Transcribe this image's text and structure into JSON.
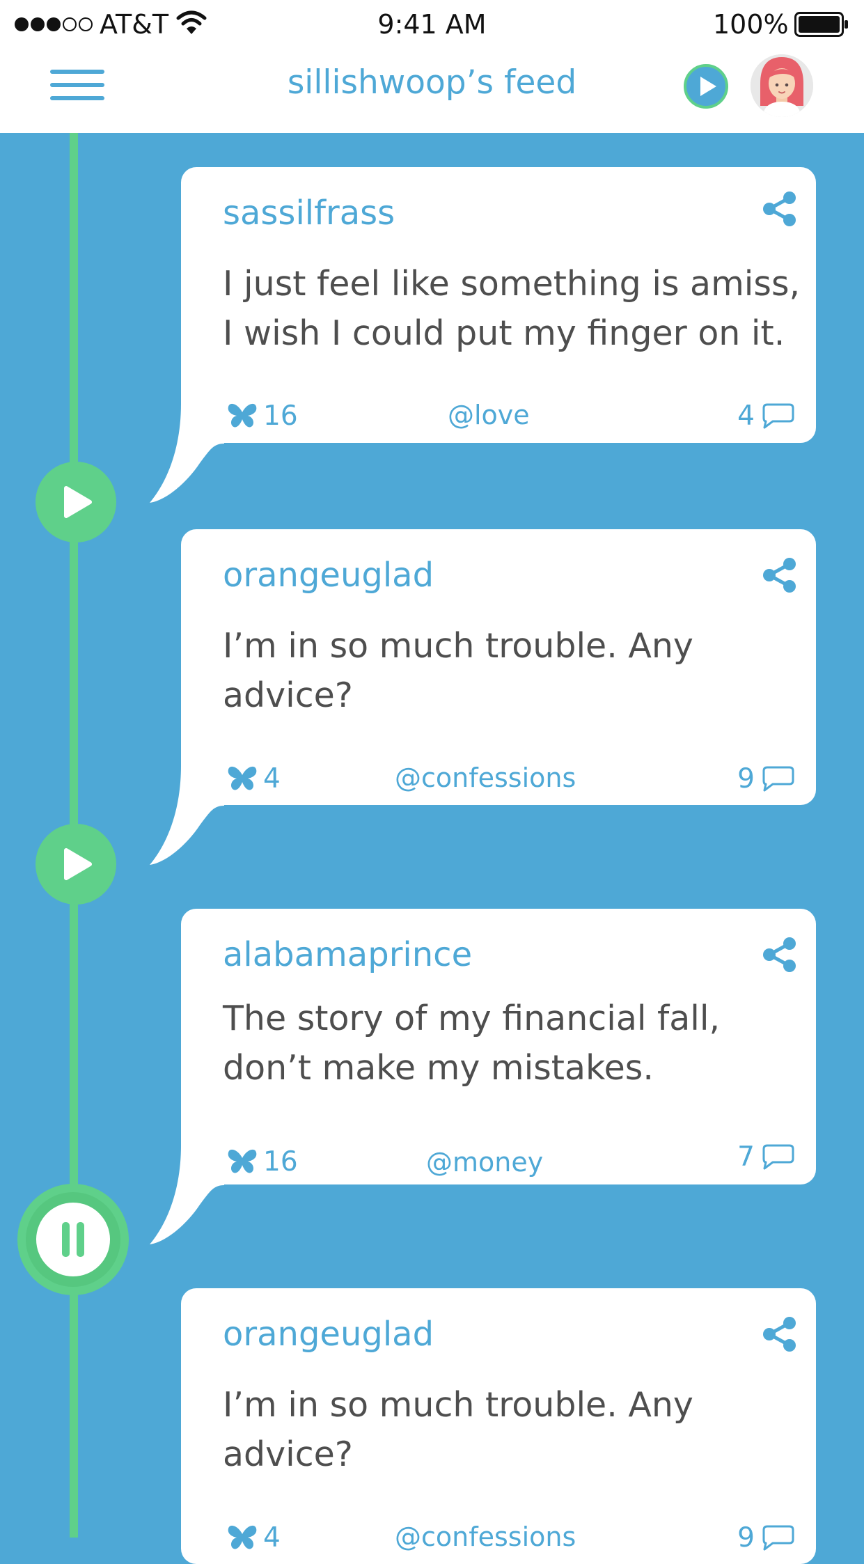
{
  "status_bar": {
    "carrier": "AT&T",
    "time": "9:41 AM",
    "battery_percent": "100%"
  },
  "nav": {
    "title": "sillishwoop’s feed"
  },
  "colors": {
    "brand_blue": "#4ea8d6",
    "timeline_green": "#5fd08a"
  },
  "feed": [
    {
      "username": "sassilfrass",
      "message": "I just feel like something is amiss, I wish I could put my finger on it.",
      "likes": "16",
      "tag": "@love",
      "comments": "4"
    },
    {
      "username": "orangeuglad",
      "message": "I’m in so much trouble. Any advice?",
      "likes": "4",
      "tag": "@confessions",
      "comments": "9"
    },
    {
      "username": "alabamaprince",
      "message": "The story of my financial fall, don’t make my mistakes.",
      "likes": "16",
      "tag": "@money",
      "comments": "7"
    },
    {
      "username": "orangeuglad",
      "message": "I’m in so much trouble. Any advice?",
      "likes": "4",
      "tag": "@confessions",
      "comments": "9"
    }
  ]
}
